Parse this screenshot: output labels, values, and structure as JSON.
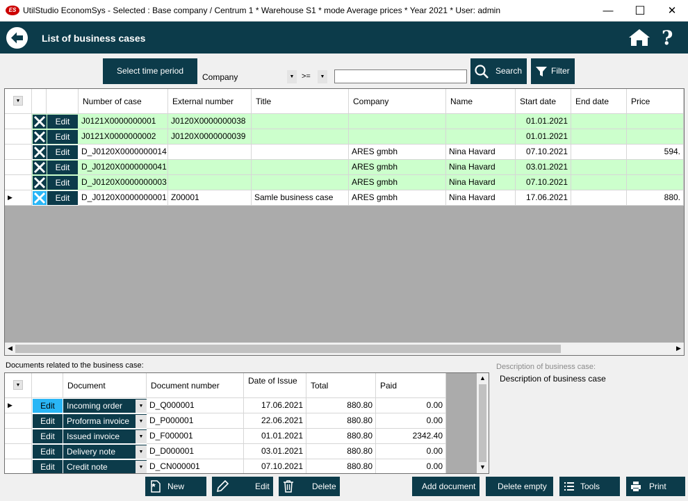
{
  "window": {
    "logo_text": "ES",
    "title": "UtilStudio EconomSys - Selected : Base company / Centrum 1 * Warehouse S1 * mode Average prices * Year 2021 * User: admin",
    "minimize": "—",
    "maximize": "☐",
    "close": "✕"
  },
  "header": {
    "title": "List of business cases",
    "help": "?"
  },
  "toolbar": {
    "period_label": "Select time period",
    "company_label": "Company",
    "operator": ">=",
    "search_value": "",
    "search_label": "Search",
    "filter_label": "Filter"
  },
  "cases": {
    "columns": [
      "Number of case",
      "External number",
      "Title",
      "Company",
      "Name",
      "Start date",
      "End date",
      "Price"
    ],
    "edit_label": "Edit",
    "rows": [
      {
        "number": "J0121X0000000001",
        "external": "J0120X0000000038",
        "title": "",
        "company": "",
        "name": "",
        "start": "01.01.2021",
        "end": "",
        "price": "",
        "color": "#ccffcc"
      },
      {
        "number": "J0121X0000000002",
        "external": "J0120X0000000039",
        "title": "",
        "company": "",
        "name": "",
        "start": "01.01.2021",
        "end": "",
        "price": "",
        "color": "#ccffcc"
      },
      {
        "number": "D_J0120X0000000014",
        "external": "",
        "title": "",
        "company": "ARES gmbh",
        "name": "Nina Havard",
        "start": "07.10.2021",
        "end": "",
        "price": "594.",
        "color": "#ffffff"
      },
      {
        "number": "D_J0120X0000000041",
        "external": "",
        "title": "",
        "company": "ARES gmbh",
        "name": "Nina Havard",
        "start": "03.01.2021",
        "end": "",
        "price": "",
        "color": "#ccffcc"
      },
      {
        "number": "D_J0120X0000000003",
        "external": "",
        "title": "",
        "company": "ARES gmbh",
        "name": "Nina Havard",
        "start": "07.10.2021",
        "end": "",
        "price": "",
        "color": "#ccffcc"
      },
      {
        "number": "D_J0120X0000000001",
        "external": "Z00001",
        "title": "Samle business case",
        "company": "ARES gmbh",
        "name": "Nina Havard",
        "start": "17.06.2021",
        "end": "",
        "price": "880.",
        "color": "#ffffff",
        "current": true
      }
    ]
  },
  "documents": {
    "section_label": "Documents related to the business case:",
    "columns": [
      "Document",
      "Document number",
      "Date of Issue",
      "Total",
      "Paid"
    ],
    "edit_label": "Edit",
    "rows": [
      {
        "type": "Incoming order",
        "number": "D_Q000001",
        "date": "17.06.2021",
        "total": "880.80",
        "paid": "0.00",
        "current": true
      },
      {
        "type": "Proforma invoice",
        "number": "D_P000001",
        "date": "22.06.2021",
        "total": "880.80",
        "paid": "0.00"
      },
      {
        "type": "Issued invoice",
        "number": "D_F000001",
        "date": "01.01.2021",
        "total": "880.80",
        "paid": "2342.40"
      },
      {
        "type": "Delivery note",
        "number": "D_D000001",
        "date": "03.01.2021",
        "total": "880.80",
        "paid": "0.00"
      },
      {
        "type": "Credit note",
        "number": "D_CN000001",
        "date": "07.10.2021",
        "total": "880.80",
        "paid": "0.00"
      }
    ]
  },
  "description": {
    "caption": "Description of business case:",
    "text": "Description of business case"
  },
  "bottom": {
    "new_label": "New",
    "edit_label": "Edit",
    "delete_label": "Delete",
    "add_document_label": "Add document",
    "delete_empty_label": "Delete empty",
    "tools_label": "Tools",
    "print_label": "Print"
  },
  "colors": {
    "accent": "#0c3b4a",
    "row_green": "#ccffcc",
    "selected_edit": "#29b6f6"
  }
}
